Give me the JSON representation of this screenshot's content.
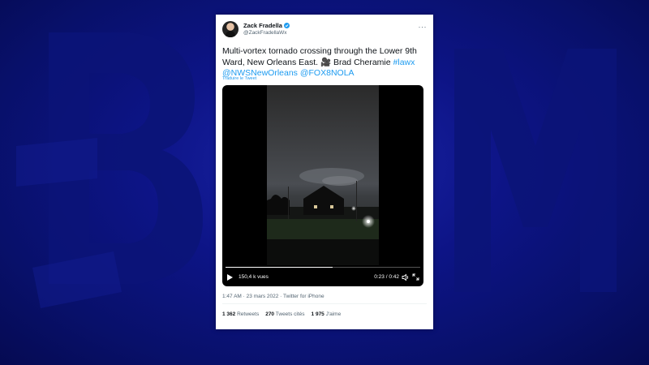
{
  "tweet": {
    "author_name": "Zack Fradella",
    "author_handle": "@ZackFradellaWx",
    "text_main": "Multi-vortex tornado crossing through the Lower 9th Ward, New Orleans East. 🎥 Brad Cheramie ",
    "hashtag": "#lawx",
    "mention_1": "@NWSNewOrleans",
    "mention_2": "@FOX8NOLA",
    "translate_label": "Traduire le Tweet",
    "more_label": "···",
    "timestamp": "1:47 AM · 23 mars 2022 · Twitter for iPhone",
    "stats": {
      "retweets_count": "1 362",
      "retweets_label": "Retweets",
      "quotes_count": "270",
      "quotes_label": "Tweets cités",
      "likes_count": "1 975",
      "likes_label": "J'aime"
    }
  },
  "video": {
    "views": "150,4 k vues",
    "time": "0:23 / 0:42",
    "progress": 0.55
  },
  "colors": {
    "background": "#0a0f6e",
    "link": "#1d9bf0",
    "verified": "#1d9bf0"
  },
  "icons": [
    "verified-badge-icon",
    "more-icon",
    "play-icon",
    "volume-icon",
    "fullscreen-icon"
  ]
}
